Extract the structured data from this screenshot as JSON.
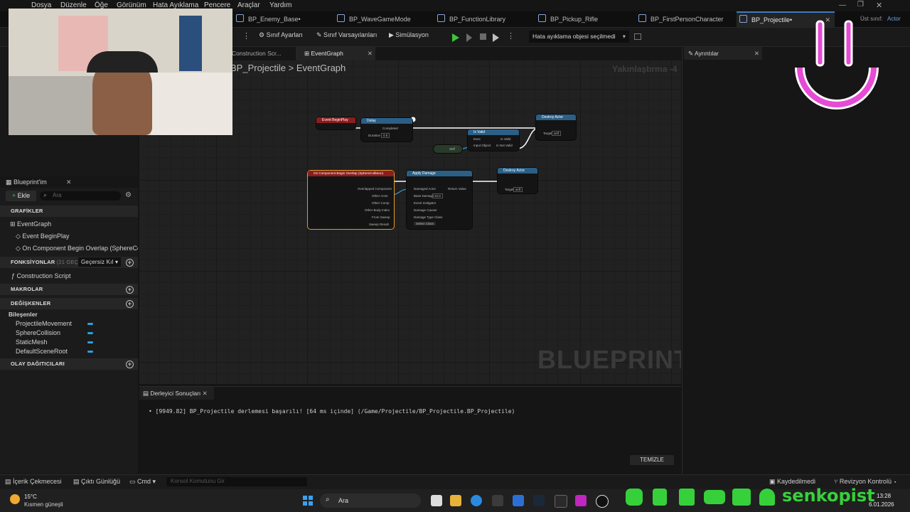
{
  "menu": [
    "Dosya",
    "Düzenle",
    "Öğe",
    "Görünüm",
    "Hata Ayıklama",
    "Pencere",
    "Araçlar",
    "Yardım"
  ],
  "doc_tabs": [
    "BP_Enemy_Base•",
    "BP_WaveGameMode",
    "BP_FunctionLibrary",
    "BP_Pickup_Rifle",
    "BP_FirstPersonCharacter",
    "BP_Projectile•"
  ],
  "parent_class": {
    "label": "Üst sınıf:",
    "value": "Actor"
  },
  "toolbar": {
    "class_settings": "Sınıf Ayarları",
    "class_defaults": "Sınıf Varsayılanları",
    "simulation": "Simülasyon",
    "debug_object": "Hata ayıklama objesi seçilmedi"
  },
  "graph_tabs": {
    "construction": "Construction Scr...",
    "event_graph": "EventGraph"
  },
  "breadcrumb": {
    "root": "BP_Projectile",
    "separator": ">",
    "current": "EventGraph"
  },
  "zoom": "Yakınlaştırma -4",
  "watermark": "BLUEPRINT",
  "details_tab": "Ayrıntılar",
  "blueprint_panel": {
    "title": "Blueprint'im",
    "add_label": "Ekle",
    "search_placeholder": "Ara",
    "graphs_header": "GRAFİKLER",
    "event_graph": "EventGraph",
    "event_begin_play": "Event BeginPlay",
    "on_component_overlap": "On Component Begin Overlap (SphereCol",
    "functions_header": "FONKSİYONLAR",
    "functions_count": "(21 GEÇERS",
    "override_label": "Geçersiz Kıl",
    "construction_script": "Construction Script",
    "macros_header": "MAKROLAR",
    "variables_header": "DEĞİŞKENLER",
    "components_header": "Bileşenler",
    "components": [
      "ProjectileMovement",
      "SphereCollision",
      "StaticMesh",
      "DefaultSceneRoot"
    ],
    "dispatchers_header": "OLAY DAĞITICILARI"
  },
  "nodes": {
    "begin_play": "Event BeginPlay",
    "delay": "Delay",
    "delay_completed": "Completed",
    "delay_duration": "Duration",
    "delay_duration_value": "0.5",
    "destroy_actor": "Destroy Actor",
    "target_label": "Target",
    "self_value": "self",
    "is_valid": "Is Valid",
    "is_valid_exec": "Exec",
    "is_valid_input": "Input Object",
    "is_valid_out": "Is Valid",
    "is_not_valid": "Is Not Valid",
    "self_node": "Self",
    "overlap": "On Component Begin Overlap (SphereCollision)",
    "overlap_pins": [
      "Overlapped Component",
      "Other Actor",
      "Other Comp",
      "Other Body Index",
      "From Sweep",
      "Sweep Result"
    ],
    "apply_damage": "Apply Damage",
    "apply_pins": [
      "Damaged Actor",
      "Base Damage",
      "Event Instigator",
      "Damage Causer",
      "Damage Type Class"
    ],
    "base_damage_value": "10.0",
    "damage_type_value": "Select Class",
    "return_value": "Return Value"
  },
  "log": {
    "tab_title": "Derleyici Sonuçları",
    "message": "[9949.82] BP_Projectile derlemesi başarılı! [64 ms içinde] (/Game/Projectile/BP_Projectile.BP_Projectile)",
    "clear_button": "TEMİZLE"
  },
  "statusbar": {
    "content_drawer": "İçerik Çekmecesi",
    "output_log": "Çıktı Günlüğü",
    "cmd": "Cmd",
    "console_placeholder": "Konsol Komutunu Gir",
    "saved": "Kaydedilmedi",
    "revision_control": "Revizyon Kontrolü"
  },
  "taskbar": {
    "weather_temp": "15°C",
    "weather_desc": "Kısmen güneşli",
    "search_label": "Ara",
    "time": "13:28",
    "date": "6.01.2026"
  },
  "overlay": {
    "channel_name": "senkopist"
  },
  "colors": {
    "accent_blue": "#3c7ac2",
    "event_red": "#8c1d1d",
    "function_blue": "#2b5f86",
    "pure_green": "#3a5b3a",
    "exec_white": "#ffffff",
    "object_pin": "#2f9fe0",
    "overlay_magenta": "#e64bd5",
    "overlay_green": "#36d13a"
  }
}
